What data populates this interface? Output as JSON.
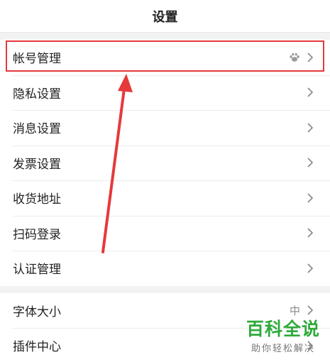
{
  "header": {
    "title": "设置"
  },
  "group1": [
    {
      "label": "帐号管理",
      "icon": "paw-icon"
    },
    {
      "label": "隐私设置"
    },
    {
      "label": "消息设置"
    },
    {
      "label": "发票设置"
    },
    {
      "label": "收货地址"
    },
    {
      "label": "扫码登录"
    },
    {
      "label": "认证管理"
    }
  ],
  "group2": [
    {
      "label": "字体大小",
      "value": "中"
    },
    {
      "label": "插件中心"
    }
  ],
  "watermark": {
    "title": "百科全说",
    "subtitle": "助你轻松解决"
  },
  "colors": {
    "highlight": "#e5393b",
    "watermark_green": "#2eaa3a",
    "background": "#f2f2f2"
  }
}
